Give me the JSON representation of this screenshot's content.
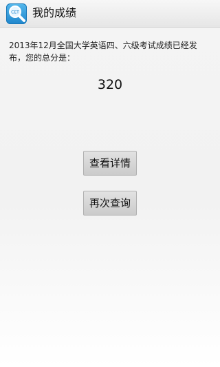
{
  "header": {
    "title": "我的成绩",
    "icon": "cet-search-app-icon",
    "icon_text": "CET"
  },
  "result": {
    "message": "2013年12月全国大学英语四、六级考试成绩已经发布，您的总分是：",
    "score": "320"
  },
  "actions": {
    "detail_label": "查看详情",
    "retry_label": "再次查询"
  }
}
